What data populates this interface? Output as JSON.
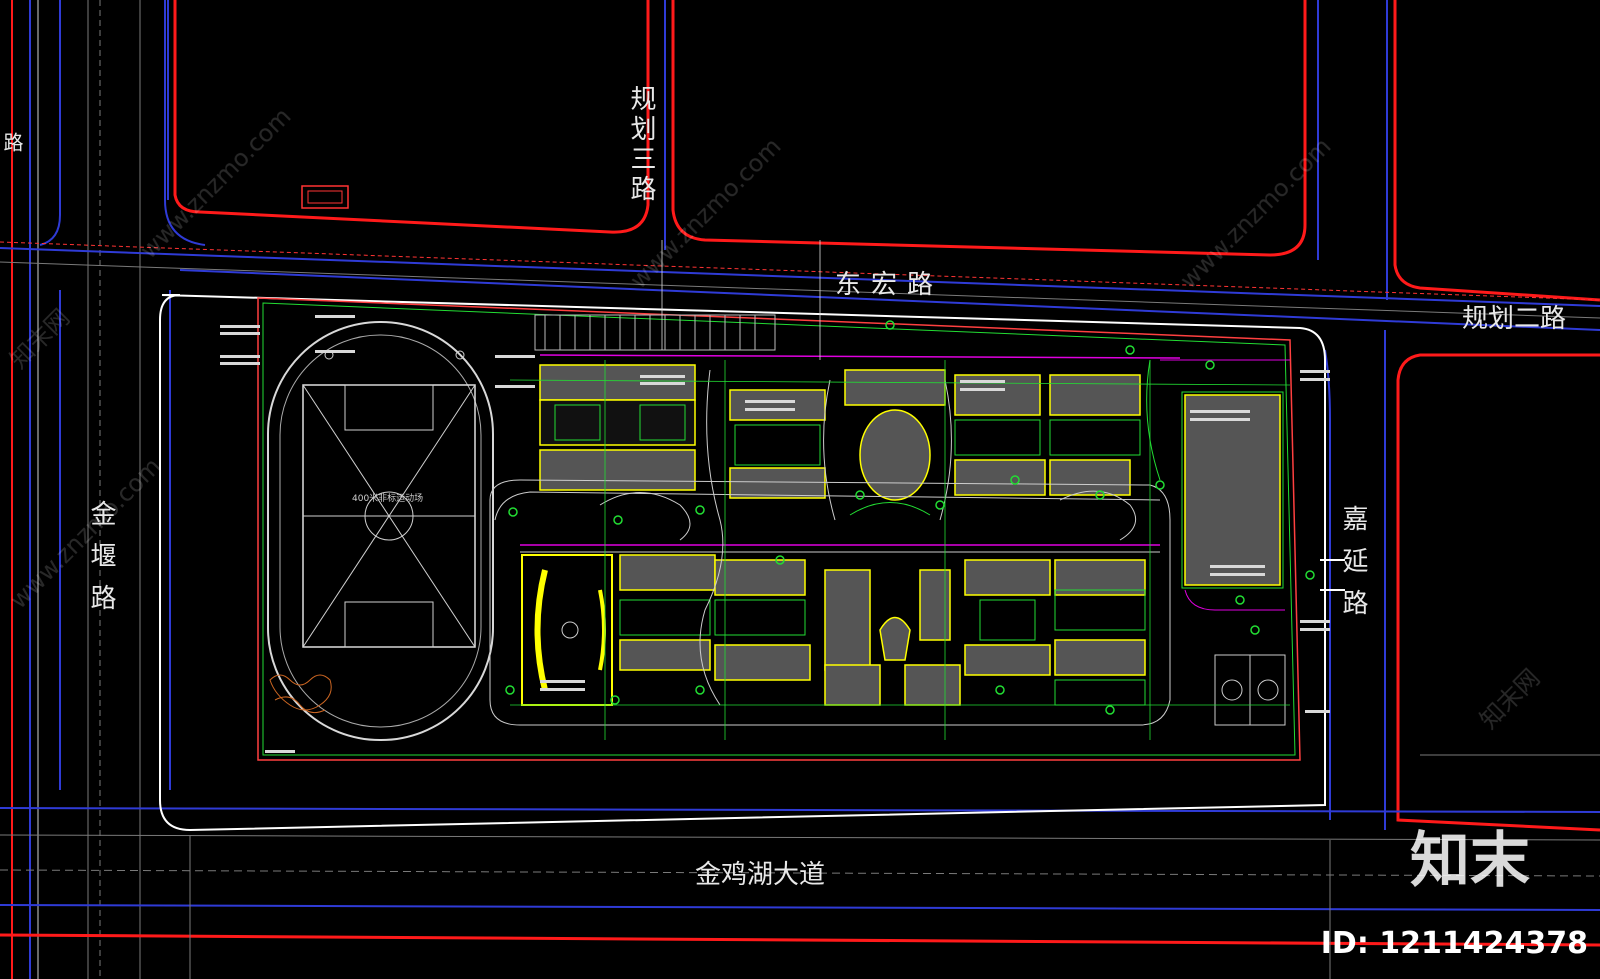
{
  "roads": {
    "top_vertical": "规划三路",
    "top_horizontal": "东宏路",
    "right_horizontal": "规划二路",
    "left_vertical": "金堰路",
    "right_vertical": "嘉延路",
    "bottom_horizontal": "金鸡湖大道",
    "left_edge_fragment": "路"
  },
  "site": {
    "track_label": "400米非标运动场"
  },
  "watermark": {
    "logo": "知末",
    "id": "ID: 1211424378",
    "site_text": "www.znzmo.com",
    "diag_text": "知末网"
  },
  "colors": {
    "background": "#000000",
    "road_edge_red": "#ff1a1a",
    "road_edge_blue": "#2f3bd6",
    "magenta": "#e000e0",
    "green": "#22dd33",
    "yellow": "#ffff00",
    "white": "#ffffff",
    "grey_fill": "#5a5a5a"
  }
}
